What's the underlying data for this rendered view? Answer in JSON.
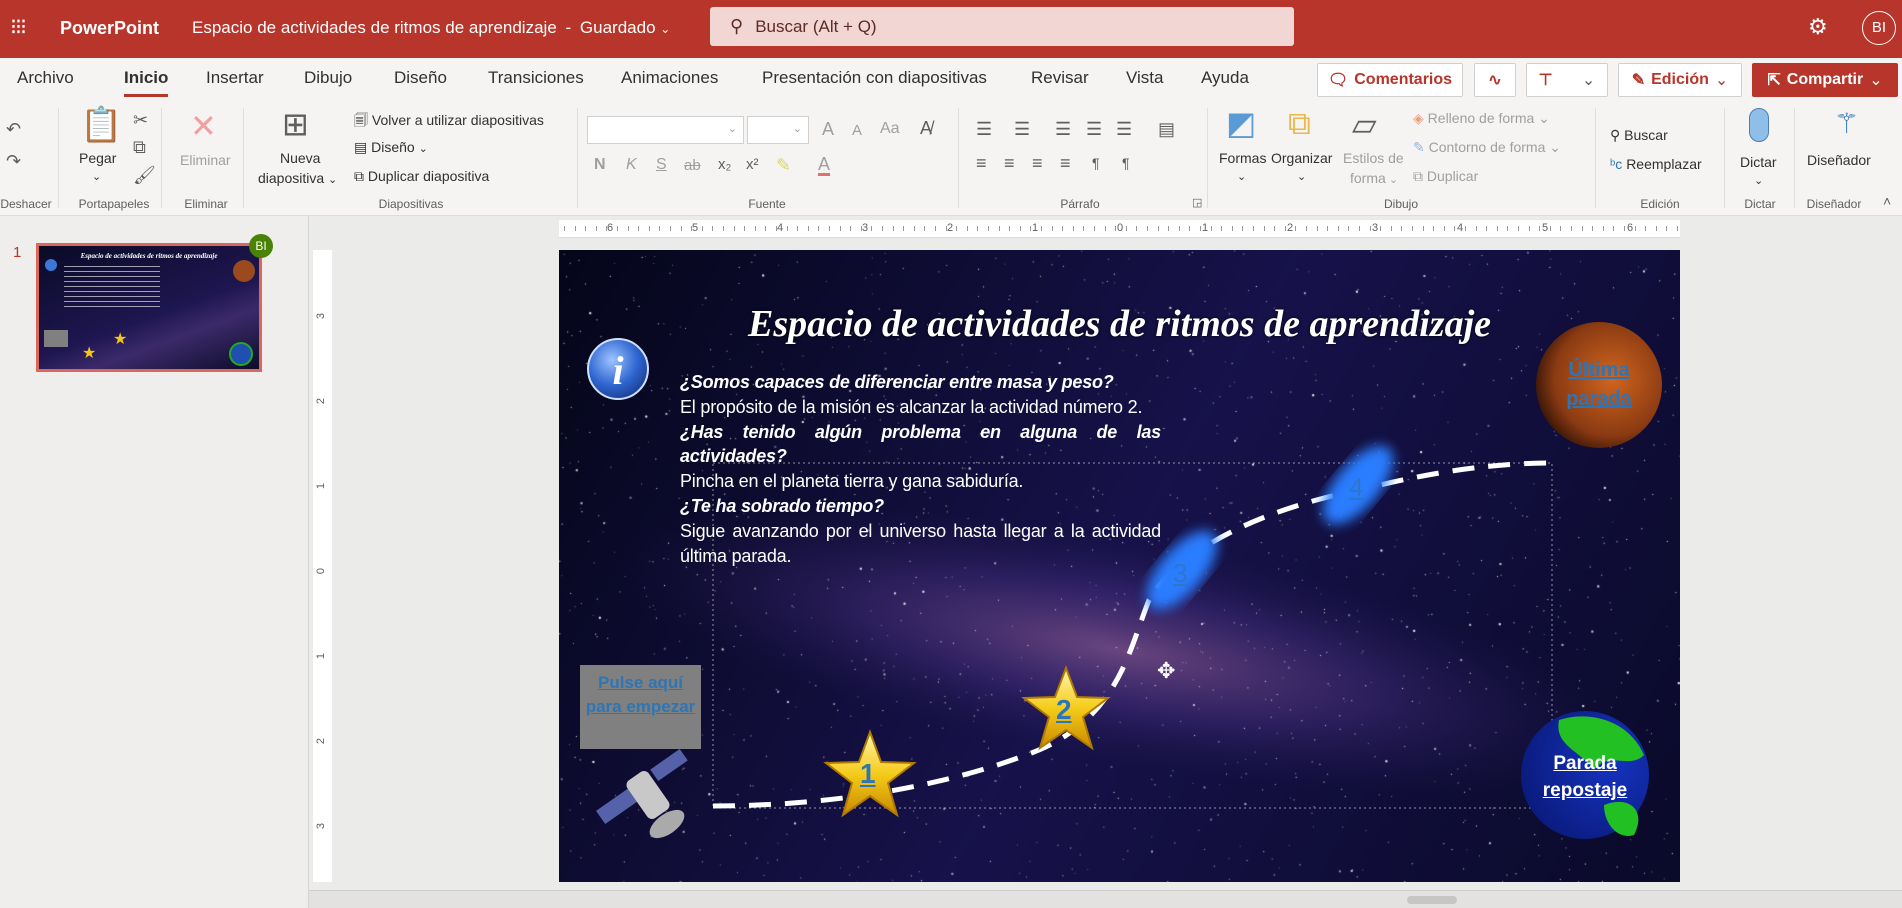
{
  "app": {
    "name": "PowerPoint",
    "doc_title": "Espacio de actividades de ritmos de aprendizaje",
    "separator": "-",
    "save_status": "Guardado",
    "search_placeholder": "Buscar (Alt + Q)",
    "avatar": "BI"
  },
  "tabs": [
    "Archivo",
    "Inicio",
    "Insertar",
    "Dibujo",
    "Diseño",
    "Transiciones",
    "Animaciones",
    "Presentación con diapositivas",
    "Revisar",
    "Vista",
    "Ayuda"
  ],
  "active_tab": "Inicio",
  "actions": {
    "comments": "Comentarios",
    "editing": "Edición",
    "share": "Compartir"
  },
  "ribbon": {
    "undo": {
      "label": "Deshacer"
    },
    "clipboard": {
      "label": "Portapapeles",
      "paste": "Pegar"
    },
    "delete": {
      "label": "Eliminar",
      "button": "Eliminar"
    },
    "slides": {
      "label": "Diapositivas",
      "new_1": "Nueva",
      "new_2": "diapositiva",
      "reuse": "Volver a utilizar diapositivas",
      "layout": "Diseño",
      "duplicate": "Duplicar diapositiva"
    },
    "font": {
      "label": "Fuente",
      "bold": "N",
      "italic": "K",
      "underline": "S",
      "strike": "ab",
      "grow": "A",
      "shrink": "A",
      "case": "Aa"
    },
    "paragraph": {
      "label": "Párrafo"
    },
    "drawing": {
      "label": "Dibujo",
      "shapes": "Formas",
      "arrange": "Organizar",
      "styles_1": "Estilos de",
      "styles_2": "forma",
      "fill": "Relleno de forma",
      "outline": "Contorno de forma",
      "duplicate": "Duplicar"
    },
    "editing": {
      "label": "Edición",
      "find": "Buscar",
      "replace": "Reemplazar"
    },
    "dictate": {
      "label": "Dictar",
      "button": "Dictar"
    },
    "designer": {
      "label": "Diseñador",
      "button": "Diseñador"
    }
  },
  "ruler": {
    "horizontal": [
      "6",
      "5",
      "4",
      "3",
      "2",
      "1",
      "0",
      "1",
      "2",
      "3",
      "4",
      "5",
      "6"
    ],
    "vertical": [
      "3",
      "2",
      "1",
      "0",
      "1",
      "2",
      "3"
    ]
  },
  "thumbnails": [
    {
      "number": "1",
      "badge": "BI"
    }
  ],
  "slide": {
    "title": "Espacio de actividades de ritmos de aprendizaje",
    "body": [
      {
        "text": "¿Somos capaces de diferenciar entre masa y peso?"
      },
      {
        "text": "El propósito de la misión es alcanzar la actividad número 2."
      },
      {
        "text": "¿Has tenido algún problema en alguna de las actividades?"
      },
      {
        "text": "Pincha en el planeta tierra y gana sabiduría."
      },
      {
        "text": "¿Te ha sobrado tiempo?"
      },
      {
        "text": "Sigue avanzando por el universo hasta llegar a la actividad última parada."
      }
    ],
    "start_button": "Pulse aquí para empezar",
    "last_stop": "Última parada",
    "refuel_stop": "Parada repostaje",
    "activities": [
      "1",
      "2",
      "3",
      "4"
    ]
  },
  "colors": {
    "brand": "#b7352a",
    "link": "#2e75b6",
    "badge": "#498205",
    "selected_thumb": "#d9685a"
  }
}
